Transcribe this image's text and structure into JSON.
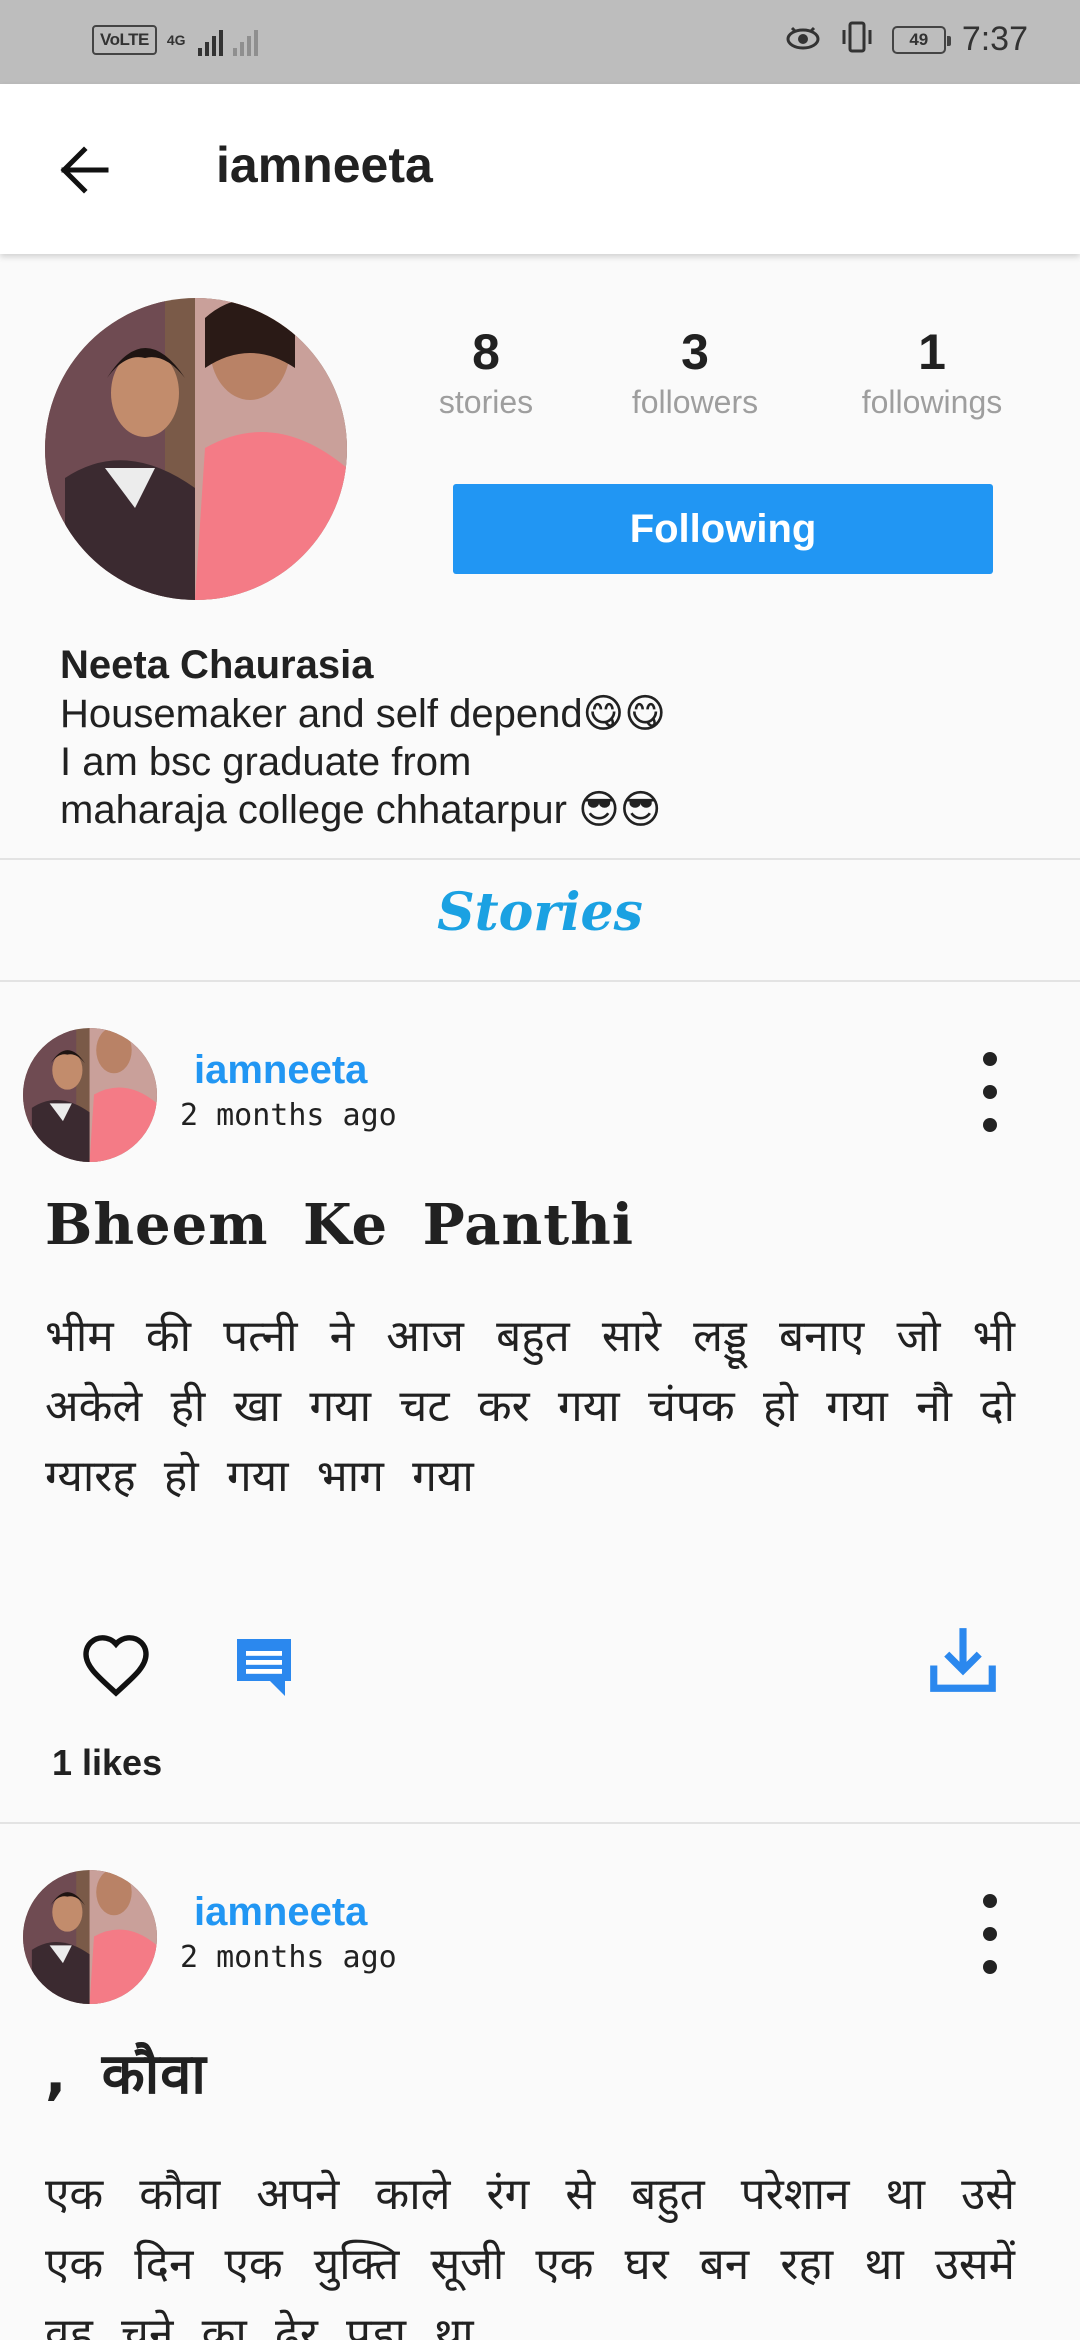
{
  "status_bar": {
    "volte_label": "VoLTE",
    "network_label": "4G",
    "battery_level": "49",
    "time": "7:37"
  },
  "app_bar": {
    "back_icon": "arrow-left-icon",
    "title": "iamneeta"
  },
  "profile": {
    "stats": [
      {
        "value": "8",
        "label": "stories"
      },
      {
        "value": "3",
        "label": "followers"
      },
      {
        "value": "1",
        "label": "followings"
      }
    ],
    "follow_button_label": "Following",
    "name": "Neeta Chaurasia",
    "bio_lines": [
      "Housemaker and self depend😋😋",
      "I am bsc graduate from",
      "maharaja college chhatarpur 😎😎"
    ]
  },
  "section_title": "Stories",
  "posts": [
    {
      "author": "iamneeta",
      "time": "2 months ago",
      "title": "Bheem Ke Panthi",
      "body": "भीम की पत्नी ने आज बहुत सारे लड्डू बनाए जो भी अकेले ही खा गया चट कर गया चंपक हो गया नौ दो ग्यारह हो गया भाग गया",
      "likes": "1 likes"
    },
    {
      "author": "iamneeta",
      "time": "2 months ago",
      "title": ", कौवा",
      "body": "एक कौवा अपने काले रंग से बहुत परेशान था उसे एक दिन एक युक्ति सूजी एक घर बन रहा था उसमें वह चूने का ढेर पड़ा था"
    }
  ],
  "colors": {
    "accent": "#2196f3",
    "section_title": "#1ba1e2",
    "status_bar": "#bdbdbd"
  }
}
